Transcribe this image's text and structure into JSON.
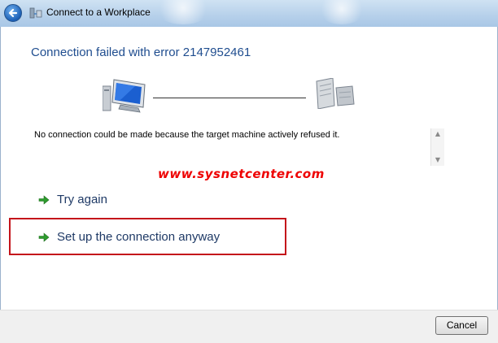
{
  "window": {
    "title": "Connect to a Workplace"
  },
  "heading": "Connection failed with error 2147952461",
  "message": "No connection could be made because the target machine actively refused it.",
  "watermark": "www.sysnetcenter.com",
  "commands": [
    {
      "label": "Try again"
    },
    {
      "label": "Set up the connection anyway"
    }
  ],
  "footer": {
    "cancel_label": "Cancel"
  },
  "colors": {
    "heading": "#1f4d8f",
    "highlight": "#c4141b",
    "watermark": "#ee0000",
    "arrow": "#2e9c2e"
  },
  "icons": {
    "back": "back-arrow-icon",
    "window": "network-connect-icon",
    "client": "computer-icon",
    "server": "server-icon",
    "command": "green-arrow-icon"
  }
}
